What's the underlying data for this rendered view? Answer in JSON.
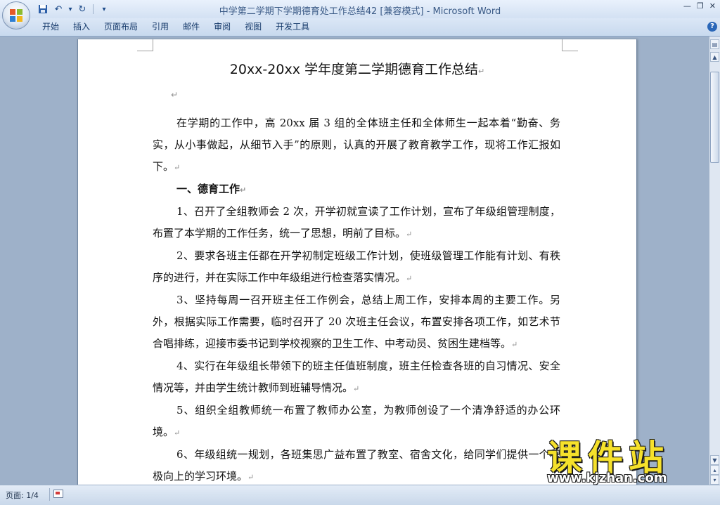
{
  "window": {
    "title": "中学第二学期下学期德育处工作总结42 [兼容模式] - Microsoft Word"
  },
  "quick_access": [
    {
      "name": "save-icon",
      "glyph": "💾"
    },
    {
      "name": "undo-icon",
      "glyph": "↶"
    },
    {
      "name": "dropdown-icon",
      "glyph": "▾"
    },
    {
      "name": "redo-icon",
      "glyph": "↻"
    },
    {
      "name": "customize-icon",
      "glyph": "▾"
    }
  ],
  "ribbon": {
    "tabs": [
      "开始",
      "插入",
      "页面布局",
      "引用",
      "邮件",
      "审阅",
      "视图",
      "开发工具"
    ],
    "help": "?"
  },
  "document": {
    "title": "20xx-20xx 学年度第二学期德育工作总结",
    "paragraph_mark": "↵",
    "paragraphs": [
      {
        "type": "body",
        "text": "在学期的工作中，高 20xx 届 3 组的全体班主任和全体师生一起本着“勤奋、务实，从小事做起，从细节入手”的原则，认真的开展了教育教学工作，现将工作汇报如下。"
      },
      {
        "type": "heading",
        "text": "一、德育工作"
      },
      {
        "type": "body",
        "text": "1、召开了全组教师会 2 次，开学初就宣读了工作计划，宣布了年级组管理制度，布置了本学期的工作任务，统一了思想，明前了目标。"
      },
      {
        "type": "body",
        "text": "2、要求各班主任都在开学初制定班级工作计划，使班级管理工作能有计划、有秩序的进行，并在实际工作中年级组进行检查落实情况。"
      },
      {
        "type": "body",
        "text": "3、坚持每周一召开班主任工作例会，总结上周工作，安排本周的主要工作。另外，根据实际工作需要，临时召开了 20 次班主任会议，布置安排各项工作，如艺术节合唱排练，迎接市委书记到学校视察的卫生工作、中考动员、贫困生建档等。"
      },
      {
        "type": "body",
        "text": "4、实行在年级组长带领下的班主任值班制度，班主任检查各班的自习情况、安全情况等，并由学生统计教师到班辅导情况。"
      },
      {
        "type": "body",
        "text": "5、组织全组教师统一布置了教师办公室，为教师创设了一个清净舒适的办公环境。"
      },
      {
        "type": "body",
        "text": "6、年级组统一规划，各班集思广益布置了教室、宿舍文化，给同学们提供一个积极向上的学习环境。"
      }
    ]
  },
  "statusbar": {
    "page": "页面: 1/4"
  },
  "watermark": {
    "brand": "课件站",
    "url": "www.kjzhan.com"
  },
  "colors": {
    "ribbon": "#c8d9ee",
    "workspace": "#9eb1c9",
    "watermark": "#f6e12b"
  }
}
